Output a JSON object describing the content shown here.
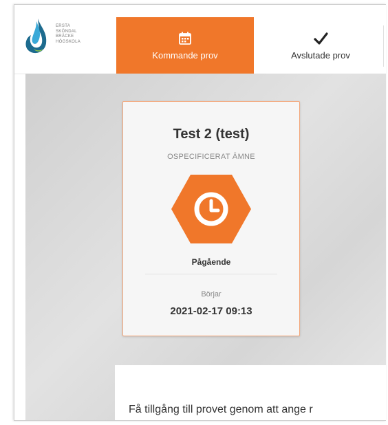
{
  "brand": {
    "logo_text_lines": [
      "ERSTA",
      "SKÖNDAL",
      "BRÄCKE",
      "HÖGSKOLA"
    ],
    "accent_color": "#f0772a"
  },
  "tabs": [
    {
      "label": "Kommande prov",
      "icon": "calendar-icon",
      "active": true
    },
    {
      "label": "Avslutade prov",
      "icon": "checkmark-icon",
      "active": false
    }
  ],
  "exam_card": {
    "title": "Test 2 (test)",
    "subject": "OSPECIFICERAT ÄMNE",
    "status_icon": "clock-icon",
    "status": "Pågående",
    "start_label": "Börjar",
    "start_datetime": "2021-02-17 09:13"
  },
  "access_text": "Få tillgång till provet genom att ange r"
}
